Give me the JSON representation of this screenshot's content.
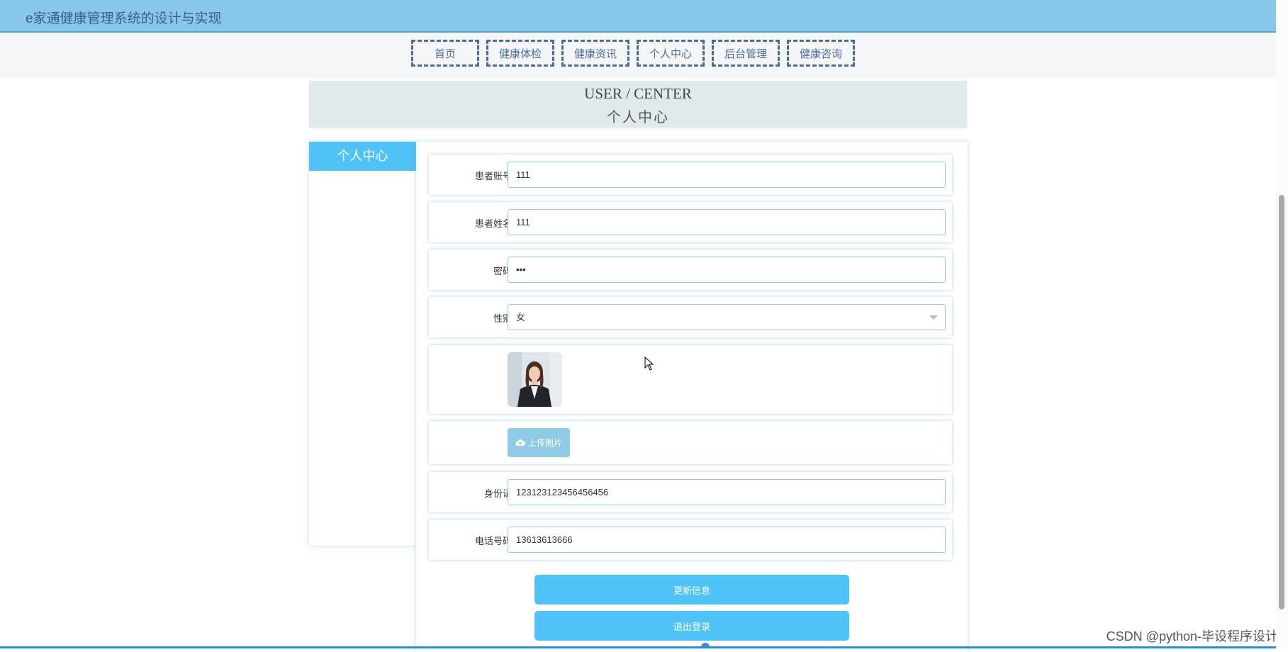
{
  "app": {
    "title": "e家通健康管理系统的设计与实现"
  },
  "nav": {
    "items": [
      "首页",
      "健康体检",
      "健康资讯",
      "个人中心",
      "后台管理",
      "健康咨询"
    ]
  },
  "header": {
    "en": "USER / CENTER",
    "cn": "个人中心"
  },
  "sidebar": {
    "title": "个人中心"
  },
  "form": {
    "account_label": "患者账号",
    "account_value": "111",
    "name_label": "患者姓名",
    "name_value": "111",
    "password_label": "密码",
    "password_value": "•••",
    "gender_label": "性别",
    "gender_value": "女",
    "upload_label": "上传图片",
    "idcard_label": "身份证",
    "idcard_value": "123123123456456456",
    "phone_label": "电话号码",
    "phone_value": "13613613666"
  },
  "buttons": {
    "update": "更新信息",
    "logout": "退出登录"
  },
  "watermark": "CSDN @python-毕设程序设计",
  "colors": {
    "accent": "#4fc3f7",
    "topbar": "#87c7e8",
    "nav_border": "#4a6c9b"
  }
}
